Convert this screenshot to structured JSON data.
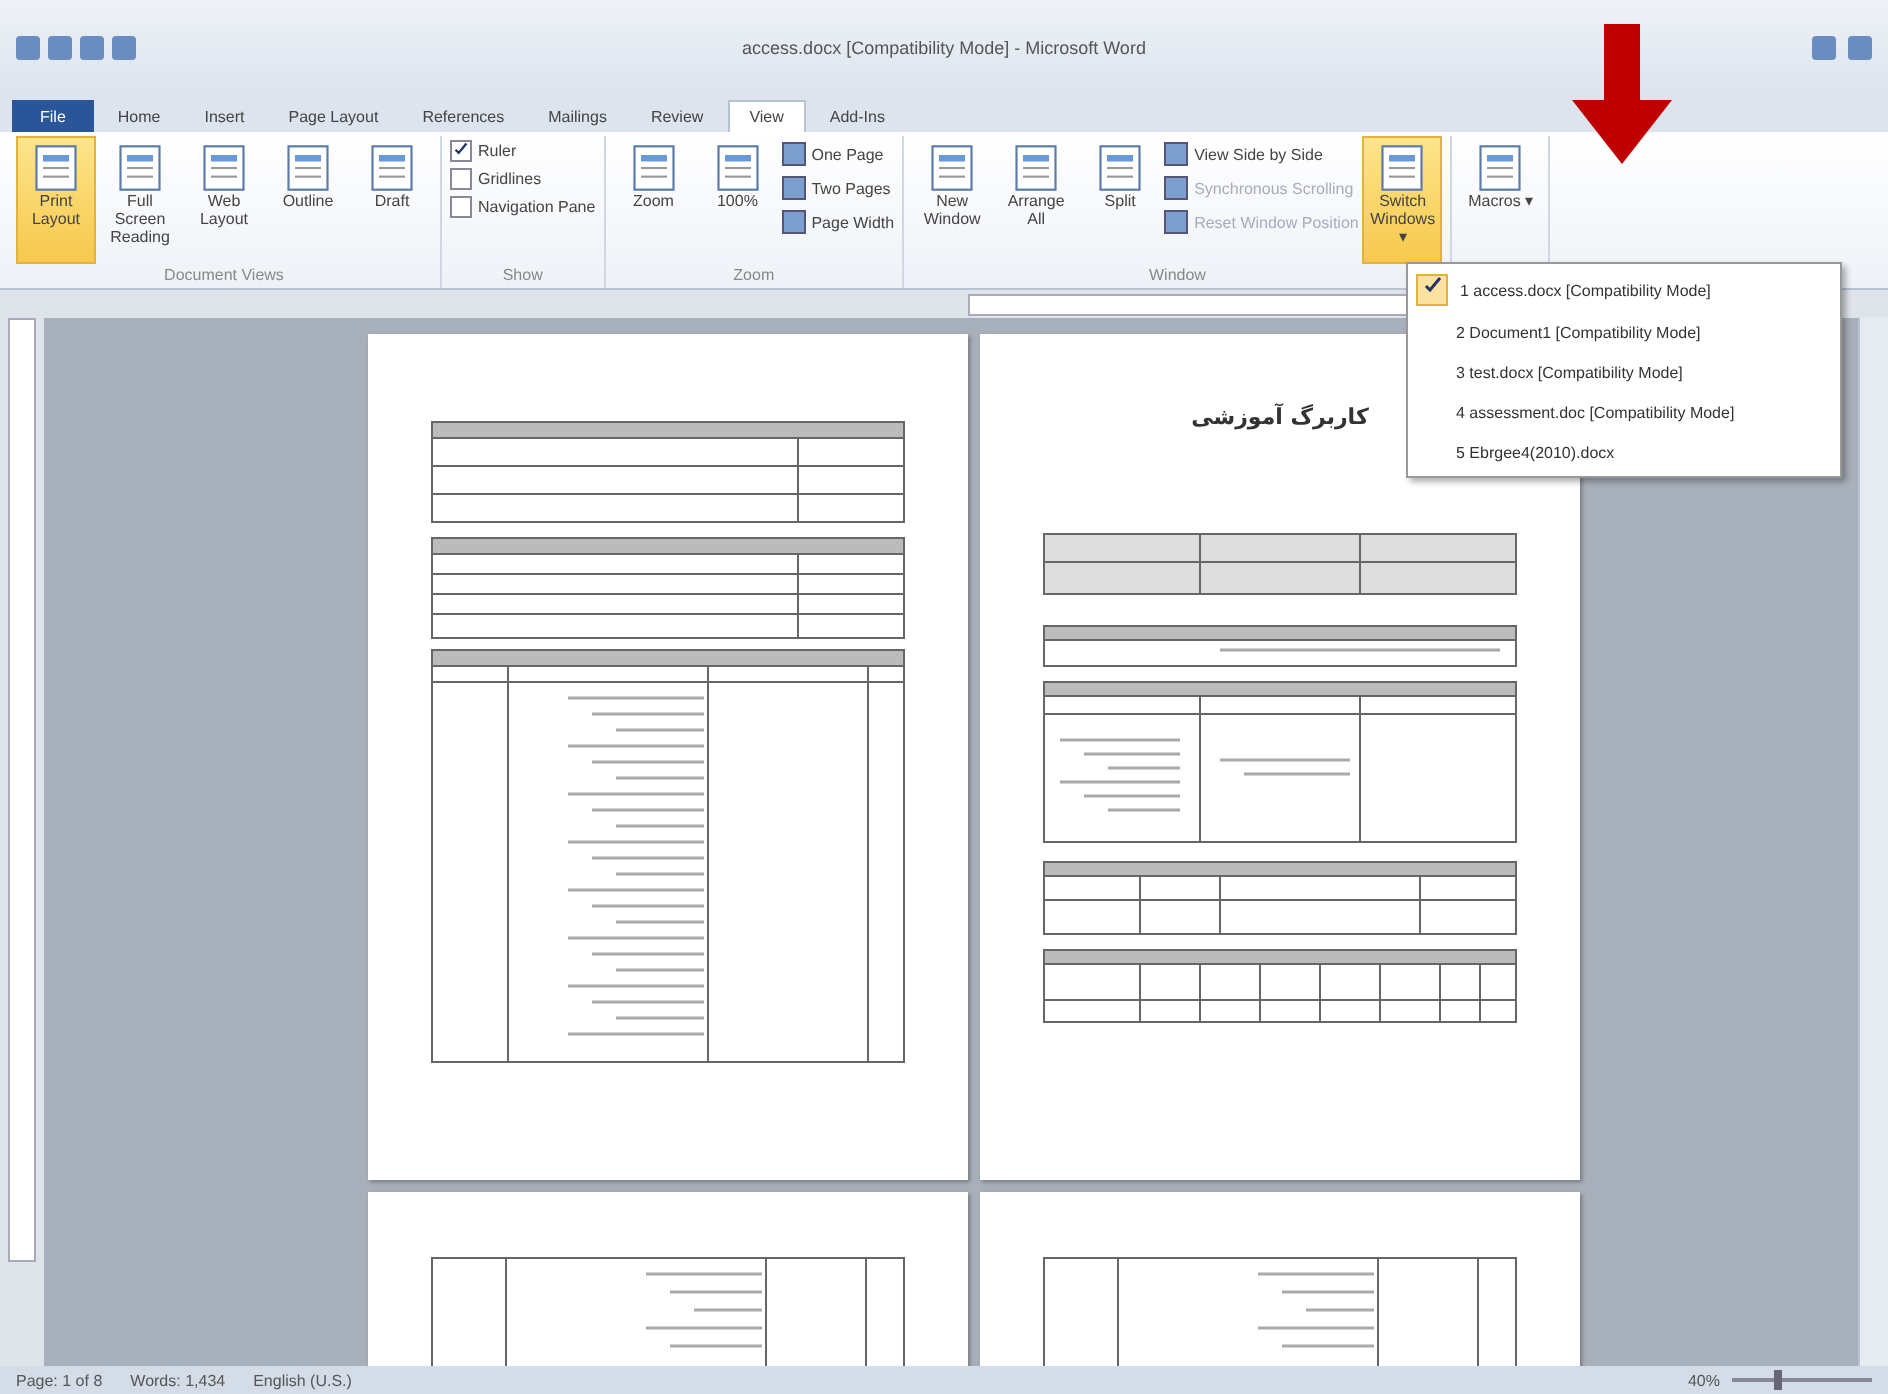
{
  "window": {
    "title": "access.docx [Compatibility Mode] - Microsoft Word"
  },
  "tabs": [
    {
      "label": "File",
      "kind": "file",
      "selected": false
    },
    {
      "label": "Home",
      "kind": "tab",
      "selected": false
    },
    {
      "label": "Insert",
      "kind": "tab",
      "selected": false
    },
    {
      "label": "Page Layout",
      "kind": "tab",
      "selected": false
    },
    {
      "label": "References",
      "kind": "tab",
      "selected": false
    },
    {
      "label": "Mailings",
      "kind": "tab",
      "selected": false
    },
    {
      "label": "Review",
      "kind": "tab",
      "selected": false
    },
    {
      "label": "View",
      "kind": "tab",
      "selected": true
    },
    {
      "label": "Add-Ins",
      "kind": "tab",
      "selected": false
    }
  ],
  "ribbon": {
    "groups": [
      {
        "label": "Document Views",
        "items": [
          {
            "kind": "large",
            "label": "Print Layout",
            "selected": true
          },
          {
            "kind": "large",
            "label": "Full Screen Reading",
            "selected": false
          },
          {
            "kind": "large",
            "label": "Web Layout",
            "selected": false
          },
          {
            "kind": "large",
            "label": "Outline",
            "selected": false
          },
          {
            "kind": "large",
            "label": "Draft",
            "selected": false
          }
        ]
      },
      {
        "label": "Show",
        "items": [
          {
            "kind": "check",
            "label": "Ruler",
            "checked": true
          },
          {
            "kind": "check",
            "label": "Gridlines",
            "checked": false
          },
          {
            "kind": "check",
            "label": "Navigation Pane",
            "checked": false
          }
        ]
      },
      {
        "label": "Zoom",
        "items": [
          {
            "kind": "large",
            "label": "Zoom",
            "selected": false
          },
          {
            "kind": "large",
            "label": "100%",
            "selected": false
          },
          {
            "kind": "small",
            "label": "One Page",
            "disabled": false
          },
          {
            "kind": "small",
            "label": "Two Pages",
            "disabled": false
          },
          {
            "kind": "small",
            "label": "Page Width",
            "disabled": false
          }
        ]
      },
      {
        "label": "Window",
        "items": [
          {
            "kind": "large",
            "label": "New Window",
            "selected": false
          },
          {
            "kind": "large",
            "label": "Arrange All",
            "selected": false
          },
          {
            "kind": "large",
            "label": "Split",
            "selected": false
          },
          {
            "kind": "small",
            "label": "View Side by Side",
            "disabled": false
          },
          {
            "kind": "small",
            "label": "Synchronous Scrolling",
            "disabled": true
          },
          {
            "kind": "small",
            "label": "Reset Window Position",
            "disabled": true
          },
          {
            "kind": "large",
            "label": "Switch Windows ▾",
            "selected": true
          }
        ]
      },
      {
        "items": [
          {
            "kind": "large",
            "label": "Macros ▾",
            "selected": false
          }
        ]
      }
    ]
  },
  "switch_menu": {
    "items": [
      {
        "label": "1 access.docx [Compatibility Mode]",
        "checked": true
      },
      {
        "label": "2 Document1 [Compatibility Mode]",
        "checked": false
      },
      {
        "label": "3 test.docx [Compatibility Mode]",
        "checked": false
      },
      {
        "label": "4 assessment.doc [Compatibility Mode]",
        "checked": false
      },
      {
        "label": "5 Ebrgee4(2010).docx",
        "checked": false
      }
    ]
  },
  "pages": [
    {
      "kind": "list-form"
    },
    {
      "kind": "title-form",
      "heading": "کاربرگ آموزشی"
    },
    {
      "kind": "list-cont"
    },
    {
      "kind": "list-cont"
    }
  ],
  "status_bar": {
    "items": [
      "Page: 1 of 8",
      "Words: 1,434",
      "English (U.S.)"
    ],
    "zoom": "40%",
    "zoom_slider": {
      "level": 0.3
    }
  }
}
